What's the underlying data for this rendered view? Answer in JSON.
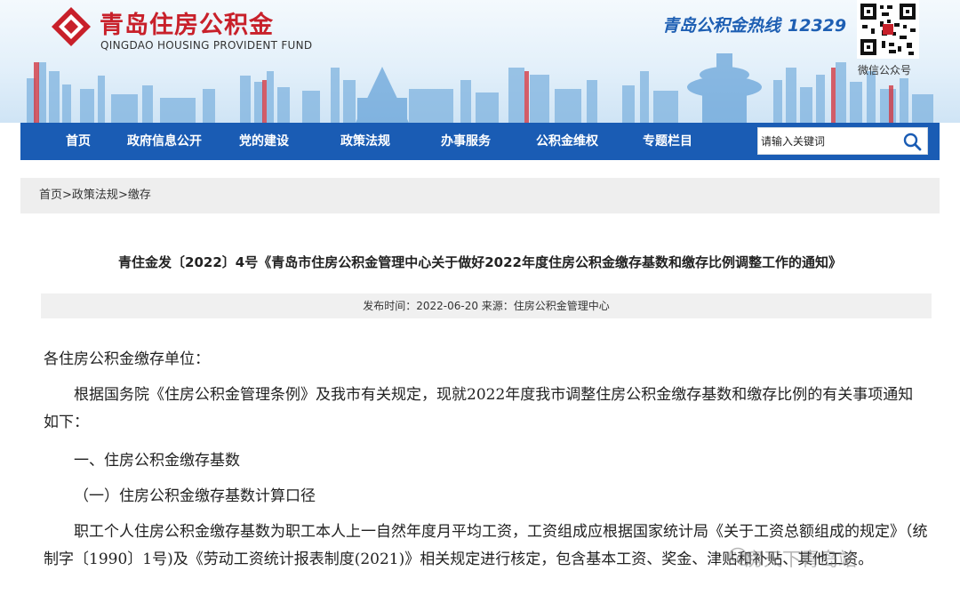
{
  "site": {
    "name_cn": "青岛住房公积金",
    "name_en": "QINGDAO HOUSING PROVIDENT FUND",
    "hotline_label": "青岛公积金热线",
    "hotline_number": "12329",
    "qr_caption": "微信公众号",
    "brand_color": "#c8202a",
    "nav_color": "#1a5cb4"
  },
  "nav": {
    "items": [
      {
        "label": "首页"
      },
      {
        "label": "政府信息公开"
      },
      {
        "label": "党的建设"
      },
      {
        "label": "政策法规"
      },
      {
        "label": "办事服务"
      },
      {
        "label": "公积金维权"
      },
      {
        "label": "专题栏目"
      }
    ],
    "search_placeholder": "请输入关键词",
    "search_icon": "search-icon"
  },
  "breadcrumb": {
    "home": "首页",
    "sep": ">",
    "level1": "政策法规",
    "level2": "缴存"
  },
  "article": {
    "title": "青住金发〔2022〕4号《青岛市住房公积金管理中心关于做好2022年度住房公积金缴存基数和缴存比例调整工作的通知》",
    "meta": "发布时间：2022-06-20 来源：住房公积金管理中心",
    "greeting": "各住房公积金缴存单位：",
    "para1": "根据国务院《住房公积金管理条例》及我市有关规定，现就2022年度我市调整住房公积金缴存基数和缴存比例的有关事项通知如下：",
    "heading1": "一、住房公积金缴存基数",
    "heading2": "（一）住房公积金缴存基数计算口径",
    "para2": "职工个人住房公积金缴存基数为职工本人上一自然年度月平均工资，工资组成应根据国家统计局《关于工资总额组成的规定》（统制字〔1990〕1号)及《劳动工资统计报表制度(2021)》相关规定进行核定，包含基本工资、奖金、津贴和补贴、其他工资。"
  },
  "watermark": {
    "text": "房天下青岛站",
    "icon": "wechat-icon"
  }
}
